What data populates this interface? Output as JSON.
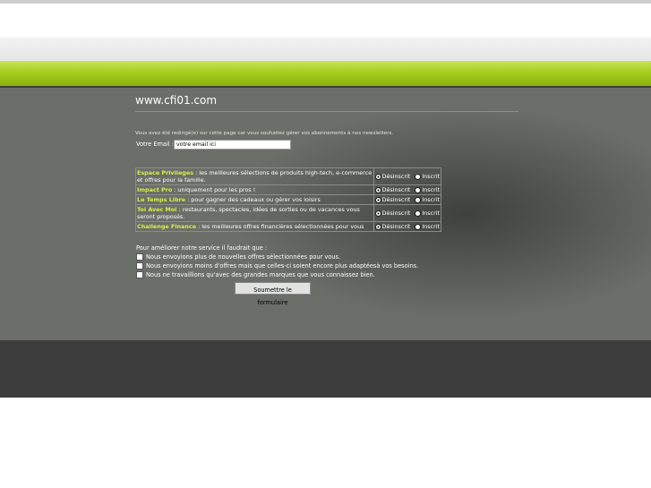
{
  "site": {
    "title": "www.cfi01.com"
  },
  "intro": "Vous avez été redirigé(e) sur cette page car vous souhaitez gérer vos abonnements à nos newsletters.",
  "email": {
    "label": "Votre Email :",
    "value": "votre email ici"
  },
  "newsletters": [
    {
      "name": "Espace Privileges",
      "desc": " : les meilleures sélections de produits high-tech, e-commerce et offres pour la famille.",
      "selected": "desinscrit"
    },
    {
      "name": "Impact Pro",
      "desc": " : uniquement pour les pros !",
      "selected": "desinscrit"
    },
    {
      "name": "Le Temps Libre",
      "desc": " : pour gagner des cadeaux ou gérer vos loisirs",
      "selected": "desinscrit"
    },
    {
      "name": "Toi Avec Moi",
      "desc": " : restaurants, spectacles, idées de sorties ou de vacances vous seront proposés.",
      "selected": "desinscrit"
    },
    {
      "name": "Challenge Finance",
      "desc": " : les meilleures offres financières sélectionnées pour vous",
      "selected": "desinscrit"
    }
  ],
  "options": {
    "unsubscribe": "Désinscrit",
    "subscribe": "Inscrit"
  },
  "improve": {
    "label": "Pour améliorer notre service il faudrait que :",
    "choices": [
      "Nous envoyions plus de nouvelles offres sélectionnées pour vous.",
      "Nous envoyions moins d'offres mais que celles-ci soient encore plus adaptéesà vos besoins.",
      "Nous ne travaillions qu'avec des grandes marques que vous connaissez bien."
    ]
  },
  "submit_label": "Soumettre le formulaire"
}
